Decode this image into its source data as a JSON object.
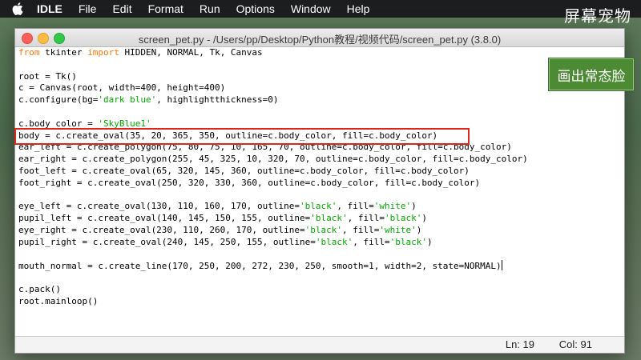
{
  "menubar": {
    "apple_icon": "apple-icon",
    "app_name": "IDLE",
    "items": [
      "File",
      "Edit",
      "Format",
      "Run",
      "Options",
      "Window",
      "Help"
    ]
  },
  "overlay_title": "屏幕宠物",
  "window": {
    "title": "screen_pet.py - /Users/pp/Desktop/Python教程/视频代码/screen_pet.py (3.8.0)"
  },
  "code": [
    [
      {
        "t": "from",
        "c": "kw"
      },
      {
        "t": " tkinter ",
        "c": ""
      },
      {
        "t": "import",
        "c": "kw"
      },
      {
        "t": " HIDDEN, NORMAL, Tk, Canvas",
        "c": ""
      }
    ],
    [],
    [
      {
        "t": "root = Tk()",
        "c": ""
      }
    ],
    [
      {
        "t": "c = Canvas(root, width=400, height=400)",
        "c": ""
      }
    ],
    [
      {
        "t": "c.configure(bg=",
        "c": ""
      },
      {
        "t": "'dark blue'",
        "c": "str"
      },
      {
        "t": ", highlightthickness=0)",
        "c": ""
      }
    ],
    [],
    [
      {
        "t": "c.body_color = ",
        "c": ""
      },
      {
        "t": "'SkyBlue1'",
        "c": "str"
      }
    ],
    [
      {
        "t": "body = c.create_oval(35, 20, 365, 350, outline=c.body_color, fill=c.body_color)",
        "c": ""
      }
    ],
    [
      {
        "t": "ear_left = c.create_polygon(75, 80, 75, 10, 165, 70, outline=c.body_color, fill=c.body_color)",
        "c": ""
      }
    ],
    [
      {
        "t": "ear_right = c.create_polygon(255, 45, 325, 10, 320, 70, outline=c.body_color, fill=c.body_color)",
        "c": ""
      }
    ],
    [
      {
        "t": "foot_left = c.create_oval(65, 320, 145, 360, outline=c.body_color, fill=c.body_color)",
        "c": ""
      }
    ],
    [
      {
        "t": "foot_right = c.create_oval(250, 320, 330, 360, outline=c.body_color, fill=c.body_color)",
        "c": ""
      }
    ],
    [],
    [
      {
        "t": "eye_left = c.create_oval(130, 110, 160, 170, outline=",
        "c": ""
      },
      {
        "t": "'black'",
        "c": "str"
      },
      {
        "t": ", fill=",
        "c": ""
      },
      {
        "t": "'white'",
        "c": "str"
      },
      {
        "t": ")",
        "c": ""
      }
    ],
    [
      {
        "t": "pupil_left = c.create_oval(140, 145, 150, 155, outline=",
        "c": ""
      },
      {
        "t": "'black'",
        "c": "str"
      },
      {
        "t": ", fill=",
        "c": ""
      },
      {
        "t": "'black'",
        "c": "str"
      },
      {
        "t": ")",
        "c": ""
      }
    ],
    [
      {
        "t": "eye_right = c.create_oval(230, 110, 260, 170, outline=",
        "c": ""
      },
      {
        "t": "'black'",
        "c": "str"
      },
      {
        "t": ", fill=",
        "c": ""
      },
      {
        "t": "'white'",
        "c": "str"
      },
      {
        "t": ")",
        "c": ""
      }
    ],
    [
      {
        "t": "pupil_right = c.create_oval(240, 145, 250, 155, outline=",
        "c": ""
      },
      {
        "t": "'black'",
        "c": "str"
      },
      {
        "t": ", fill=",
        "c": ""
      },
      {
        "t": "'black'",
        "c": "str"
      },
      {
        "t": ")",
        "c": ""
      }
    ],
    [],
    [
      {
        "t": "mouth_normal = c.create_line(170, 250, 200, 272, 230, 250, smooth=1, width=2, state=NORMAL)",
        "c": ""
      }
    ],
    [],
    [
      {
        "t": "c.pack()",
        "c": ""
      }
    ],
    [
      {
        "t": "root.mainloop()",
        "c": ""
      }
    ]
  ],
  "cursor_line": 18,
  "status": {
    "ln": "Ln: 19",
    "col": "Col: 91"
  },
  "action_button": "画出常态脸",
  "colors": {
    "keyword": "#ff7700",
    "string": "#00aa00",
    "highlight_box": "#e0251b",
    "button_bg": "#4c8a34"
  }
}
